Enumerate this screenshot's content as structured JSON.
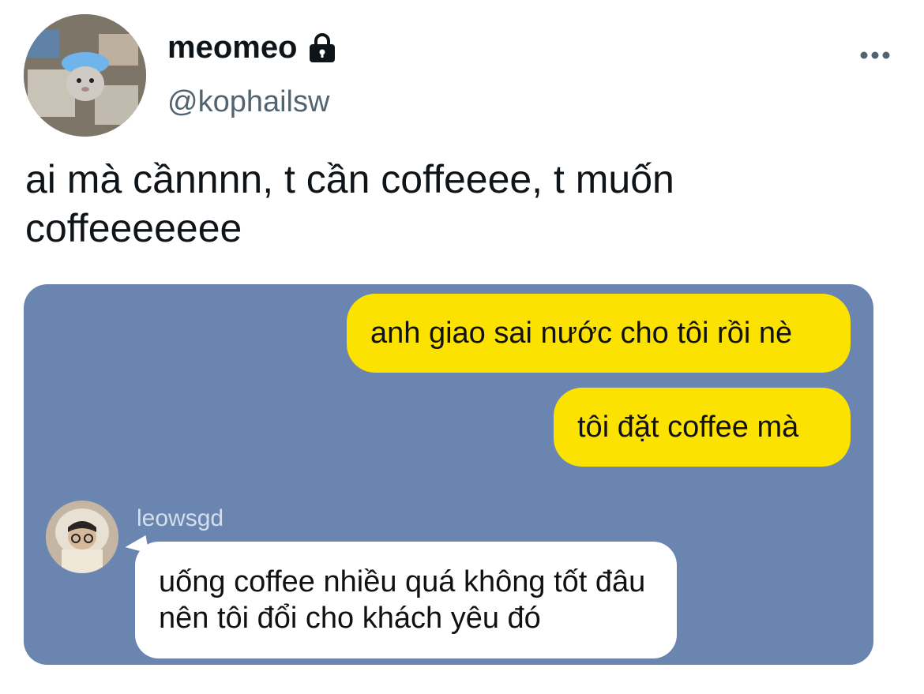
{
  "user": {
    "display_name": "meomeo",
    "handle": "@kophailsw",
    "protected_icon": "lock-icon",
    "avatar_icon": "hamster-avatar"
  },
  "header": {
    "more_icon": "more-horizontal-icon"
  },
  "tweet": {
    "text": "ai mà cầnnnn, t cần coffeeee, t muốn coffeeeeeee"
  },
  "chat_image": {
    "background_color": "#6a86b0",
    "outgoing_color": "#fbe200",
    "messages": [
      {
        "direction": "outgoing",
        "text": "anh giao sai nước cho tôi rồi nè"
      },
      {
        "direction": "outgoing",
        "text": "tôi đặt coffee mà"
      },
      {
        "direction": "incoming",
        "sender": "leowsgd",
        "text": "uống coffee nhiều quá không tốt đâu nên tôi đổi cho khách yêu đó"
      }
    ]
  }
}
